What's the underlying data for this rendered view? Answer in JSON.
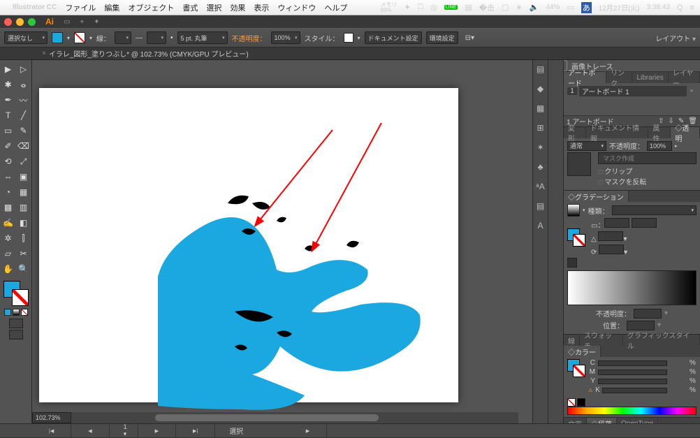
{
  "menubar": {
    "app": "Illustrator CC",
    "items": [
      "ファイル",
      "編集",
      "オブジェクト",
      "書式",
      "選択",
      "効果",
      "表示",
      "ウィンドウ",
      "ヘルプ"
    ],
    "right": {
      "memory": "メモリ\n99%",
      "battery": "44%",
      "date": "12月27日(火)",
      "time": "3:38:43"
    }
  },
  "controlbar": {
    "noselection": "選択なし",
    "stroke_label": "線：",
    "stroke_weight": "5 pt. 丸筆",
    "opacity_label": "不透明度：",
    "opacity": "100%",
    "style_label": "スタイル：",
    "docsetup": "ドキュメント設定",
    "prefs": "環境設定",
    "layout": "レイアウト"
  },
  "tab": {
    "title": "イラレ_図形_塗りつぶし* @ 102.73% (CMYK/GPU プレビュー)"
  },
  "zoom": "102.73%",
  "imagetrace": "画像トレース",
  "panels": {
    "artboard": {
      "tabs": [
        "アートボード",
        "リンク",
        "Libraries",
        "レイヤー"
      ],
      "row": {
        "num": "1",
        "name": "アートボード 1"
      },
      "count": "1 アートボード"
    },
    "transparency": {
      "tabs": [
        "変形",
        "ドキュメント情報",
        "属性",
        "◇透明"
      ],
      "mode": "通常",
      "opacity_label": "不透明度：",
      "opacity": "100%",
      "makemask": "マスク作成",
      "clip": "クリップ",
      "invert": "マスクを反転"
    },
    "gradient": {
      "tabs": [
        "◇グラデーション"
      ],
      "type_label": "種類：",
      "opacity_label": "不透明度：",
      "pos_label": "位置："
    },
    "color": {
      "tabs": [
        "線",
        "スウォッチ",
        "グラフィックスタイル"
      ],
      "tabs2": [
        "◇カラー"
      ],
      "c": "C",
      "m": "M",
      "y": "Y",
      "k": "K",
      "pct": "%"
    },
    "bottom": {
      "tabs": [
        "文字",
        "◇段落",
        "OpenType"
      ]
    }
  },
  "statusbar": {
    "sel": "選択"
  }
}
